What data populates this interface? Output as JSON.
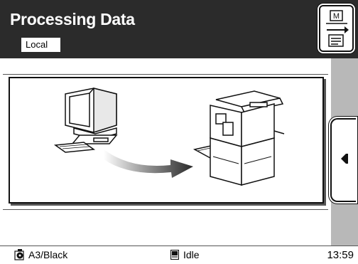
{
  "header": {
    "title": "Processing Data",
    "tag": "Local",
    "mode_button_icon": "m-arrow-doc-icon"
  },
  "stage": {
    "illustration": [
      "computer-icon",
      "transfer-arrow-icon",
      "printer-icon"
    ]
  },
  "side_panel": {
    "toggle_icon": "collapse-left-icon"
  },
  "status": {
    "paper": "A3/Black",
    "paper_icon": "printer-drum-icon",
    "state": "Idle",
    "state_icon": "memory-icon",
    "time": "13:59"
  },
  "colors": {
    "header_bg": "#2b2b2b",
    "rail_bg": "#b8b8b8"
  }
}
